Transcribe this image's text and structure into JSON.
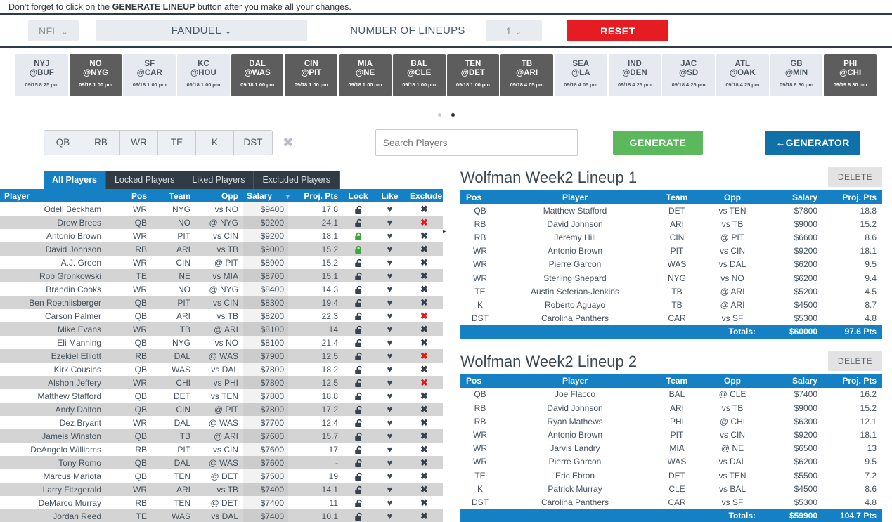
{
  "notice": {
    "before": "Don't forget to click on the ",
    "bold": "GENERATE LINEUP",
    "after": " button after you make all your changes."
  },
  "toolbar": {
    "sport": "NFL",
    "site": "FANDUEL",
    "lineups_label": "NUMBER OF LINEUPS",
    "lineups_count": "1",
    "reset_label": "RESET",
    "caret": "⌄",
    "reset_color": "#e51c23"
  },
  "games": {
    "prev_icon": "‹",
    "next_icon": "›",
    "items": [
      {
        "away": "NYJ",
        "home": "@BUF",
        "datetime": "09/15 8:25 pm",
        "selected": false
      },
      {
        "away": "NO",
        "home": "@NYG",
        "datetime": "09/18 1:00 pm",
        "selected": true
      },
      {
        "away": "SF",
        "home": "@CAR",
        "datetime": "09/18 1:00 pm",
        "selected": false
      },
      {
        "away": "KC",
        "home": "@HOU",
        "datetime": "09/18 1:00 pm",
        "selected": false
      },
      {
        "away": "DAL",
        "home": "@WAS",
        "datetime": "09/18 1:00 pm",
        "selected": true
      },
      {
        "away": "CIN",
        "home": "@PIT",
        "datetime": "09/18 1:00 pm",
        "selected": true
      },
      {
        "away": "MIA",
        "home": "@NE",
        "datetime": "09/18 1:00 pm",
        "selected": true
      },
      {
        "away": "BAL",
        "home": "@CLE",
        "datetime": "09/18 1:00 pm",
        "selected": true
      },
      {
        "away": "TEN",
        "home": "@DET",
        "datetime": "09/18 1:00 pm",
        "selected": true
      },
      {
        "away": "TB",
        "home": "@ARI",
        "datetime": "09/18 4:05 pm",
        "selected": true
      },
      {
        "away": "SEA",
        "home": "@LA",
        "datetime": "09/18 4:05 pm",
        "selected": false
      },
      {
        "away": "IND",
        "home": "@DEN",
        "datetime": "09/18 4:25 pm",
        "selected": false
      },
      {
        "away": "JAC",
        "home": "@SD",
        "datetime": "09/18 4:25 pm",
        "selected": false
      },
      {
        "away": "ATL",
        "home": "@OAK",
        "datetime": "09/18 4:25 pm",
        "selected": false
      },
      {
        "away": "GB",
        "home": "@MIN",
        "datetime": "09/18 8:30 pm",
        "selected": false
      },
      {
        "away": "PHI",
        "home": "@CHI",
        "datetime": "09/19 8:30 pm",
        "selected": true
      }
    ],
    "dots": [
      false,
      true
    ]
  },
  "filters": {
    "positions": [
      "QB",
      "RB",
      "WR",
      "TE",
      "K",
      "DST"
    ],
    "clear_icon": "✖",
    "search_placeholder": "Search Players",
    "search_value": "",
    "generate_label": "GENERATE",
    "generator_label": "GENERATOR",
    "generator_arrow": "←"
  },
  "player_panel": {
    "tabs": [
      {
        "label": "All Players",
        "active": true
      },
      {
        "label": "Locked Players",
        "active": false
      },
      {
        "label": "Liked Players",
        "active": false
      },
      {
        "label": "Excluded Players",
        "active": false
      }
    ],
    "columns": [
      "Player",
      "Pos",
      "Team",
      "Opp",
      "Salary",
      "Proj. Pts",
      "Lock",
      "Like",
      "Exclude"
    ],
    "sorted_column": "Salary",
    "sort_caret": "▼",
    "rows": [
      {
        "player": "Odell Beckham",
        "pos": "WR",
        "team": "NYG",
        "opp": "vs NO",
        "salary": "$9400",
        "proj": "17.8",
        "locked": false,
        "excluded": false
      },
      {
        "player": "Drew Brees",
        "pos": "QB",
        "team": "NO",
        "opp": "@ NYG",
        "salary": "$9200",
        "proj": "24.1",
        "locked": false,
        "excluded": true
      },
      {
        "player": "Antonio Brown",
        "pos": "WR",
        "team": "PIT",
        "opp": "vs CIN",
        "salary": "$9200",
        "proj": "18.1",
        "locked": true,
        "excluded": false
      },
      {
        "player": "David Johnson",
        "pos": "RB",
        "team": "ARI",
        "opp": "vs TB",
        "salary": "$9000",
        "proj": "15.2",
        "locked": true,
        "excluded": false
      },
      {
        "player": "A.J. Green",
        "pos": "WR",
        "team": "CIN",
        "opp": "@ PIT",
        "salary": "$8900",
        "proj": "15.2",
        "locked": false,
        "excluded": false
      },
      {
        "player": "Rob Gronkowski",
        "pos": "TE",
        "team": "NE",
        "opp": "vs MIA",
        "salary": "$8700",
        "proj": "15.1",
        "locked": false,
        "excluded": false
      },
      {
        "player": "Brandin Cooks",
        "pos": "WR",
        "team": "NO",
        "opp": "@ NYG",
        "salary": "$8400",
        "proj": "14.3",
        "locked": false,
        "excluded": false
      },
      {
        "player": "Ben Roethlisberger",
        "pos": "QB",
        "team": "PIT",
        "opp": "vs CIN",
        "salary": "$8300",
        "proj": "19.4",
        "locked": false,
        "excluded": false
      },
      {
        "player": "Carson Palmer",
        "pos": "QB",
        "team": "ARI",
        "opp": "vs TB",
        "salary": "$8200",
        "proj": "22.3",
        "locked": false,
        "excluded": true
      },
      {
        "player": "Mike Evans",
        "pos": "WR",
        "team": "TB",
        "opp": "@ ARI",
        "salary": "$8100",
        "proj": "14",
        "locked": false,
        "excluded": false
      },
      {
        "player": "Eli Manning",
        "pos": "QB",
        "team": "NYG",
        "opp": "vs NO",
        "salary": "$8100",
        "proj": "21.4",
        "locked": false,
        "excluded": false
      },
      {
        "player": "Ezekiel Elliott",
        "pos": "RB",
        "team": "DAL",
        "opp": "@ WAS",
        "salary": "$7900",
        "proj": "12.5",
        "locked": false,
        "excluded": true
      },
      {
        "player": "Kirk Cousins",
        "pos": "QB",
        "team": "WAS",
        "opp": "vs DAL",
        "salary": "$7800",
        "proj": "18.2",
        "locked": false,
        "excluded": false
      },
      {
        "player": "Alshon Jeffery",
        "pos": "WR",
        "team": "CHI",
        "opp": "vs PHI",
        "salary": "$7800",
        "proj": "12.5",
        "locked": false,
        "excluded": true
      },
      {
        "player": "Matthew Stafford",
        "pos": "QB",
        "team": "DET",
        "opp": "vs TEN",
        "salary": "$7800",
        "proj": "18.8",
        "locked": false,
        "excluded": false
      },
      {
        "player": "Andy Dalton",
        "pos": "QB",
        "team": "CIN",
        "opp": "@ PIT",
        "salary": "$7800",
        "proj": "17.2",
        "locked": false,
        "excluded": false
      },
      {
        "player": "Dez Bryant",
        "pos": "WR",
        "team": "DAL",
        "opp": "@ WAS",
        "salary": "$7700",
        "proj": "12.4",
        "locked": false,
        "excluded": false
      },
      {
        "player": "Jameis Winston",
        "pos": "QB",
        "team": "TB",
        "opp": "@ ARI",
        "salary": "$7600",
        "proj": "15.7",
        "locked": false,
        "excluded": false
      },
      {
        "player": "DeAngelo Williams",
        "pos": "RB",
        "team": "PIT",
        "opp": "vs CIN",
        "salary": "$7600",
        "proj": "17",
        "locked": false,
        "excluded": false
      },
      {
        "player": "Tony Romo",
        "pos": "QB",
        "team": "DAL",
        "opp": "@ WAS",
        "salary": "$7600",
        "proj": "-",
        "locked": false,
        "excluded": false
      },
      {
        "player": "Marcus Mariota",
        "pos": "QB",
        "team": "TEN",
        "opp": "@ DET",
        "salary": "$7500",
        "proj": "19",
        "locked": false,
        "excluded": false
      },
      {
        "player": "Larry Fitzgerald",
        "pos": "WR",
        "team": "ARI",
        "opp": "vs TB",
        "salary": "$7400",
        "proj": "14.1",
        "locked": false,
        "excluded": false
      },
      {
        "player": "DeMarco Murray",
        "pos": "RB",
        "team": "TEN",
        "opp": "@ DET",
        "salary": "$7400",
        "proj": "11",
        "locked": false,
        "excluded": false
      },
      {
        "player": "Jordan Reed",
        "pos": "TE",
        "team": "WAS",
        "opp": "vs DAL",
        "salary": "$7400",
        "proj": "10.1",
        "locked": false,
        "excluded": false
      }
    ]
  },
  "lineups": [
    {
      "title": "Wolfman Week2 Lineup 1",
      "delete_label": "DELETE",
      "columns": [
        "Pos",
        "Player",
        "Team",
        "Opp",
        "Salary",
        "Proj. Pts"
      ],
      "rows": [
        {
          "pos": "QB",
          "player": "Matthew Stafford",
          "team": "DET",
          "opp": "vs TEN",
          "salary": "$7800",
          "proj": "18.8"
        },
        {
          "pos": "RB",
          "player": "David Johnson",
          "team": "ARI",
          "opp": "vs TB",
          "salary": "$9000",
          "proj": "15.2"
        },
        {
          "pos": "RB",
          "player": "Jeremy Hill",
          "team": "CIN",
          "opp": "@ PIT",
          "salary": "$6600",
          "proj": "8.6"
        },
        {
          "pos": "WR",
          "player": "Antonio Brown",
          "team": "PIT",
          "opp": "vs CIN",
          "salary": "$9200",
          "proj": "18.1"
        },
        {
          "pos": "WR",
          "player": "Pierre Garcon",
          "team": "WAS",
          "opp": "vs DAL",
          "salary": "$6200",
          "proj": "9.5"
        },
        {
          "pos": "WR",
          "player": "Sterling Shepard",
          "team": "NYG",
          "opp": "vs NO",
          "salary": "$6200",
          "proj": "9.4"
        },
        {
          "pos": "TE",
          "player": "Austin Seferian-Jenkins",
          "team": "TB",
          "opp": "@ ARI",
          "salary": "$5200",
          "proj": "4.5"
        },
        {
          "pos": "K",
          "player": "Roberto Aguayo",
          "team": "TB",
          "opp": "@ ARI",
          "salary": "$4500",
          "proj": "8.7"
        },
        {
          "pos": "DST",
          "player": "Carolina Panthers",
          "team": "CAR",
          "opp": "vs SF",
          "salary": "$5300",
          "proj": "4.8"
        }
      ],
      "totals_label": "Totals:",
      "totals_salary": "$60000",
      "totals_proj": "97.6 Pts"
    },
    {
      "title": "Wolfman Week2 Lineup 2",
      "delete_label": "DELETE",
      "columns": [
        "Pos",
        "Player",
        "Team",
        "Opp",
        "Salary",
        "Proj. Pts"
      ],
      "rows": [
        {
          "pos": "QB",
          "player": "Joe Flacco",
          "team": "BAL",
          "opp": "@ CLE",
          "salary": "$7400",
          "proj": "16.2"
        },
        {
          "pos": "RB",
          "player": "David Johnson",
          "team": "ARI",
          "opp": "vs TB",
          "salary": "$9000",
          "proj": "15.2"
        },
        {
          "pos": "RB",
          "player": "Ryan Mathews",
          "team": "PHI",
          "opp": "@ CHI",
          "salary": "$6300",
          "proj": "12.1"
        },
        {
          "pos": "WR",
          "player": "Antonio Brown",
          "team": "PIT",
          "opp": "vs CIN",
          "salary": "$9200",
          "proj": "18.1"
        },
        {
          "pos": "WR",
          "player": "Jarvis Landry",
          "team": "MIA",
          "opp": "@ NE",
          "salary": "$6500",
          "proj": "13"
        },
        {
          "pos": "WR",
          "player": "Pierre Garcon",
          "team": "WAS",
          "opp": "vs DAL",
          "salary": "$6200",
          "proj": "9.5"
        },
        {
          "pos": "TE",
          "player": "Eric Ebron",
          "team": "DET",
          "opp": "vs TEN",
          "salary": "$5500",
          "proj": "7.2"
        },
        {
          "pos": "K",
          "player": "Patrick Murray",
          "team": "CLE",
          "opp": "vs BAL",
          "salary": "$4500",
          "proj": "8.6"
        },
        {
          "pos": "DST",
          "player": "Carolina Panthers",
          "team": "CAR",
          "opp": "vs SF",
          "salary": "$5300",
          "proj": "4.8"
        }
      ],
      "totals_label": "Totals:",
      "totals_salary": "$59900",
      "totals_proj": "104.7 Pts"
    }
  ],
  "colors": {
    "header_blue": "#1580c4",
    "tab_dark": "#2f3b45",
    "green": "#5cb85c",
    "red": "#e51c23",
    "lock_green": "#3aa93a"
  }
}
